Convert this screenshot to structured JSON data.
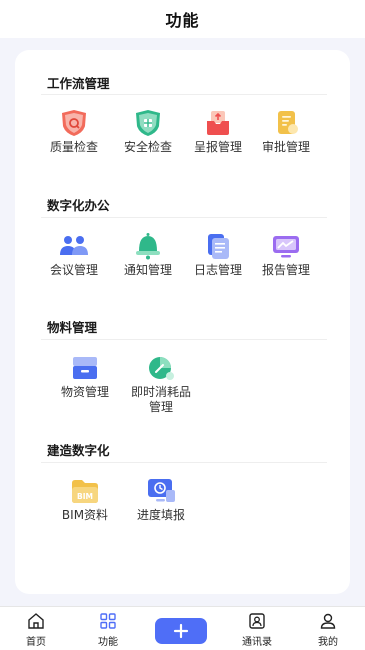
{
  "header": {
    "title": "功能"
  },
  "sections": [
    {
      "title": "工作流管理",
      "items": [
        {
          "label": "质量检查",
          "icon": "quality-check-shield-icon"
        },
        {
          "label": "安全检查",
          "icon": "safety-check-shield-icon"
        },
        {
          "label": "呈报管理",
          "icon": "submission-tray-icon"
        },
        {
          "label": "审批管理",
          "icon": "approval-document-icon"
        }
      ]
    },
    {
      "title": "数字化办公",
      "items": [
        {
          "label": "会议管理",
          "icon": "meeting-people-icon"
        },
        {
          "label": "通知管理",
          "icon": "notification-bell-icon"
        },
        {
          "label": "日志管理",
          "icon": "log-document-icon"
        },
        {
          "label": "报告管理",
          "icon": "report-chart-icon"
        }
      ]
    },
    {
      "title": "物料管理",
      "items": [
        {
          "label": "物资管理",
          "icon": "materials-box-icon"
        },
        {
          "label": "即时消耗品管理",
          "icon": "consumables-pie-icon"
        }
      ]
    },
    {
      "title": "建造数字化",
      "items": [
        {
          "label": "BIM资料",
          "icon": "bim-folder-icon"
        },
        {
          "label": "进度填报",
          "icon": "progress-monitor-icon"
        }
      ]
    }
  ],
  "consumables_label_line1": "即时消耗品",
  "consumables_label_line2": "管理",
  "bim_text": "BIM",
  "tabbar": {
    "home": "首页",
    "functions": "功能",
    "add": "+",
    "contacts": "通讯录",
    "mine": "我的"
  },
  "colors": {
    "accent": "#4f6ef7",
    "card": "#ffffff",
    "background": "#f3f4fb"
  }
}
